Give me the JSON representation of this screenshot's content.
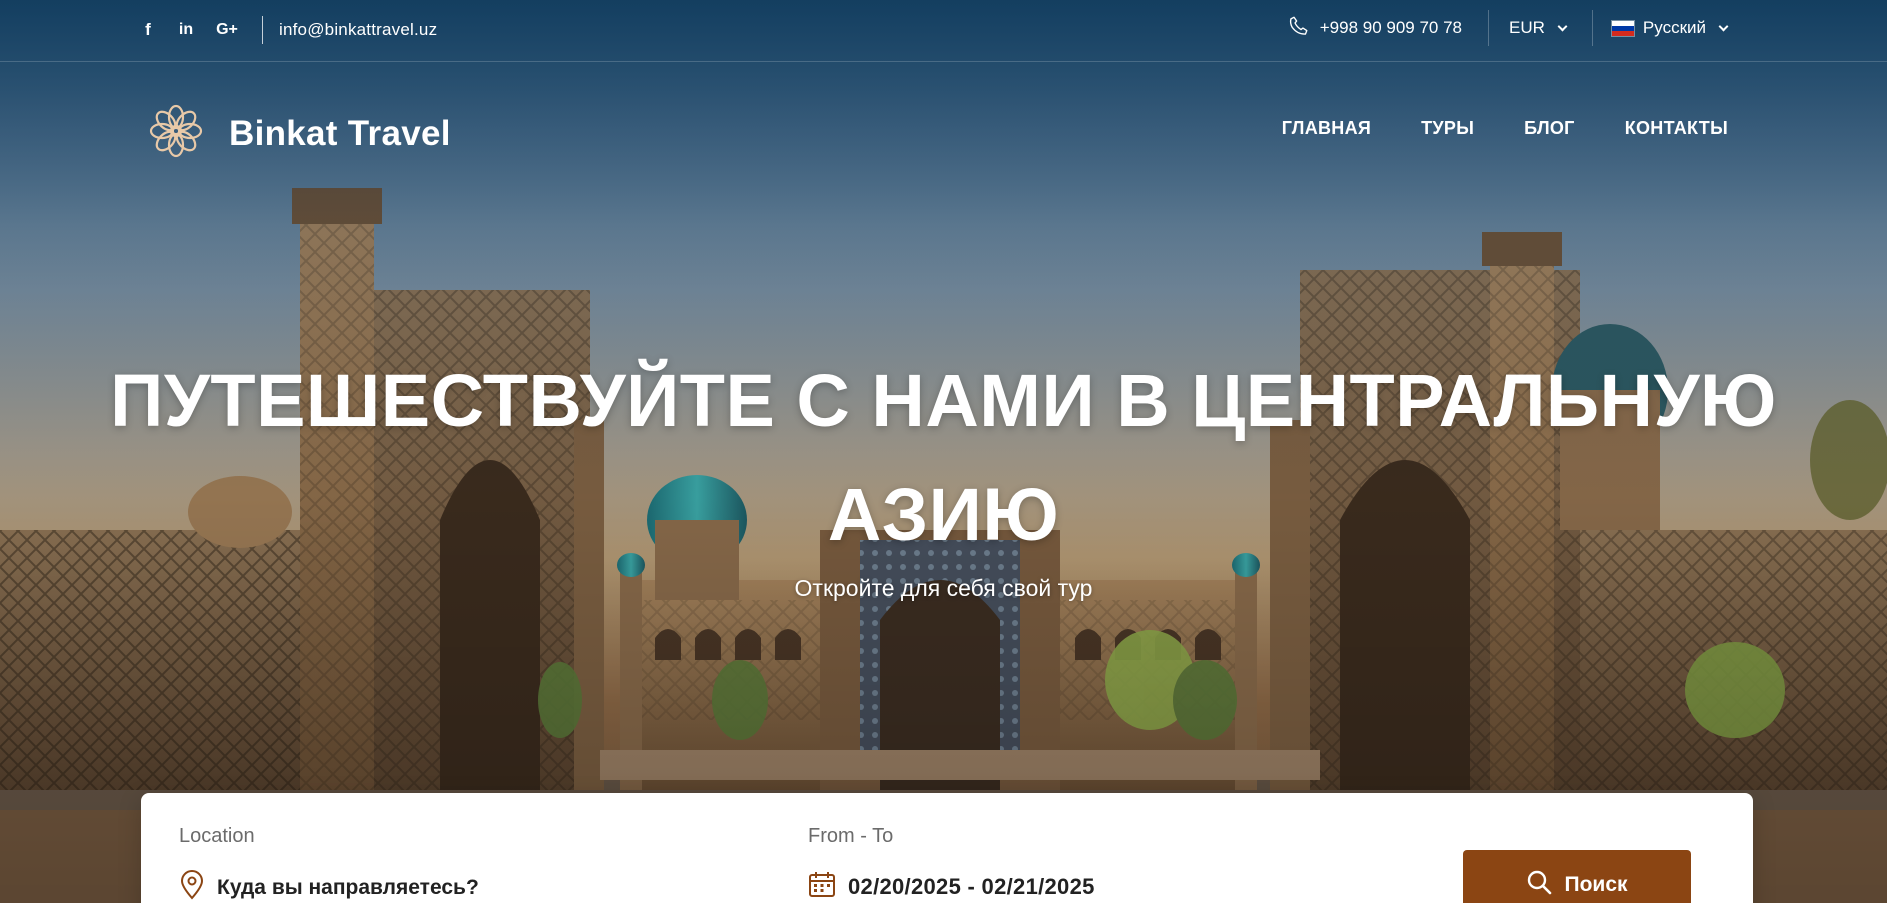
{
  "topbar": {
    "social": [
      {
        "name": "facebook",
        "glyph": "f"
      },
      {
        "name": "linkedin",
        "glyph": "in"
      },
      {
        "name": "google-plus",
        "glyph": "G+"
      }
    ],
    "email": "info@binkattravel.uz",
    "phone": "+998 90 909 70 78",
    "currency": "EUR",
    "language": "Русский"
  },
  "header": {
    "brand": "Binkat Travel",
    "nav": [
      "ГЛАВНАЯ",
      "ТУРЫ",
      "БЛОГ",
      "КОНТАКТЫ"
    ]
  },
  "hero": {
    "title": "ПУТЕШЕСТВУЙТЕ С НАМИ В ЦЕНТРАЛЬНУЮ АЗИЮ",
    "subtitle": "Откройте для себя свой тур"
  },
  "search": {
    "location_label": "Location",
    "location_placeholder": "Куда вы направляетесь?",
    "dates_label": "From - To",
    "dates_value": "02/20/2025 - 02/21/2025",
    "button_label": "Поиск"
  },
  "colors": {
    "accent": "#8b4513",
    "logo": "#e8c9a8"
  }
}
